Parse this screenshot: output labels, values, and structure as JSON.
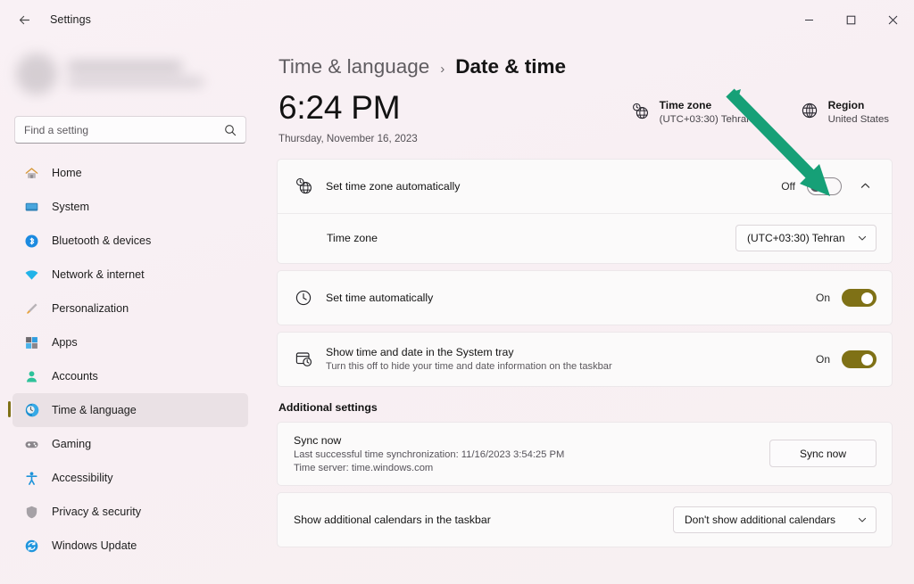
{
  "titlebar": {
    "back_icon": "back-arrow-icon",
    "title": "Settings",
    "minimize": "–",
    "maximize": "☐",
    "close": "✕"
  },
  "sidebar": {
    "search": {
      "placeholder": "Find a setting",
      "value": "",
      "icon": "search-icon"
    },
    "items": [
      {
        "label": "Home",
        "icon": "home-icon",
        "selected": false
      },
      {
        "label": "System",
        "icon": "system-icon",
        "selected": false
      },
      {
        "label": "Bluetooth & devices",
        "icon": "bluetooth-icon",
        "selected": false
      },
      {
        "label": "Network & internet",
        "icon": "wifi-icon",
        "selected": false
      },
      {
        "label": "Personalization",
        "icon": "paintbrush-icon",
        "selected": false
      },
      {
        "label": "Apps",
        "icon": "apps-icon",
        "selected": false
      },
      {
        "label": "Accounts",
        "icon": "account-icon",
        "selected": false
      },
      {
        "label": "Time & language",
        "icon": "time-language-icon",
        "selected": true
      },
      {
        "label": "Gaming",
        "icon": "gamepad-icon",
        "selected": false
      },
      {
        "label": "Accessibility",
        "icon": "accessibility-icon",
        "selected": false
      },
      {
        "label": "Privacy & security",
        "icon": "shield-icon",
        "selected": false
      },
      {
        "label": "Windows Update",
        "icon": "update-icon",
        "selected": false
      }
    ]
  },
  "breadcrumb": {
    "parent": "Time & language",
    "separator": "›",
    "current": "Date & time"
  },
  "clock": {
    "time": "6:24 PM",
    "date": "Thursday, November 16, 2023"
  },
  "info": [
    {
      "title": "Time zone",
      "value": "(UTC+03:30) Tehran",
      "icon": "timezone-globe-icon"
    },
    {
      "title": "Region",
      "value": "United States",
      "icon": "globe-icon"
    }
  ],
  "settings": {
    "set_timezone_auto": {
      "title": "Set time zone automatically",
      "icon": "timezone-globe-icon",
      "state_label": "Off",
      "state": "off",
      "expander_icon": "chevron-up-icon"
    },
    "timezone_row": {
      "title": "Time zone",
      "dropdown_value": "(UTC+03:30) Tehran",
      "dropdown_icon": "chevron-down-icon"
    },
    "set_time_auto": {
      "title": "Set time automatically",
      "icon": "clock-icon",
      "state_label": "On",
      "state": "on"
    },
    "show_tray": {
      "title": "Show time and date in the System tray",
      "subtitle": "Turn this off to hide your time and date information on the taskbar",
      "icon": "tray-clock-icon",
      "state_label": "On",
      "state": "on"
    }
  },
  "additional": {
    "heading": "Additional settings",
    "sync": {
      "title": "Sync now",
      "last_sync": "Last successful time synchronization: 11/16/2023 3:54:25 PM",
      "time_server": "Time server: time.windows.com",
      "button_label": "Sync now"
    },
    "calendars": {
      "title": "Show additional calendars in the taskbar",
      "dropdown_value": "Don't show additional calendars",
      "dropdown_icon": "chevron-down-icon"
    }
  },
  "annotation": {
    "type": "arrow",
    "color": "#16a077",
    "points_to": "set-timezone-automatically-toggle"
  },
  "colors": {
    "page_background": "#f8eff3",
    "card_background": "#fbfafa",
    "accent": "#7f7116",
    "annotation_green": "#16a077"
  }
}
